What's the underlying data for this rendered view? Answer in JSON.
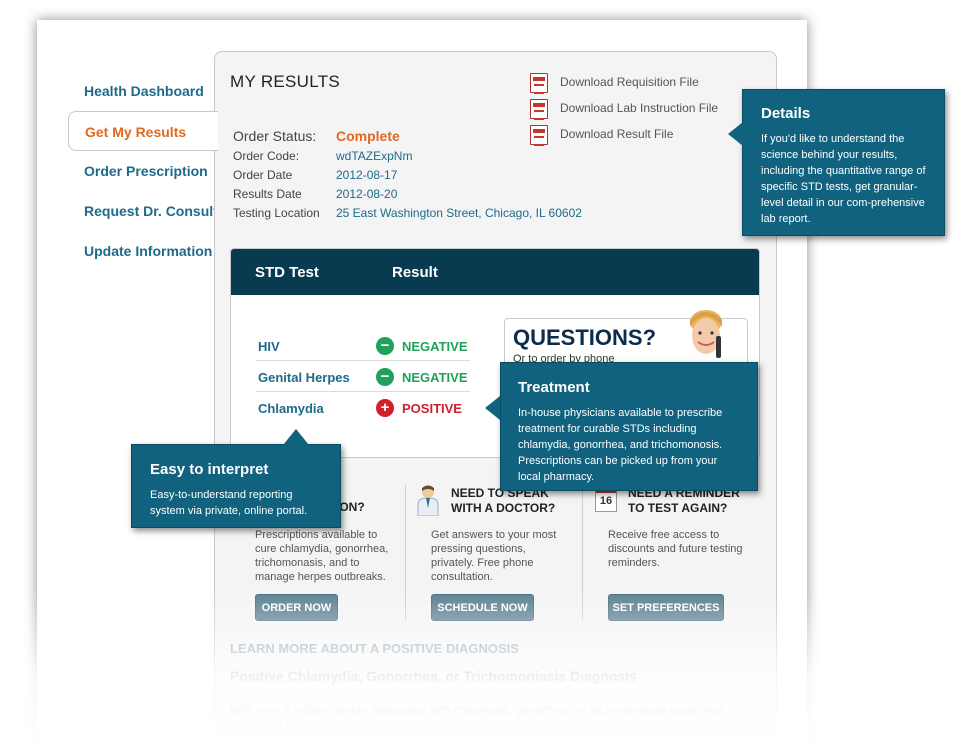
{
  "sidebar": {
    "items": [
      {
        "label": "Health Dashboard"
      },
      {
        "label": "Get My Results"
      },
      {
        "label": "Order Prescription"
      },
      {
        "label": "Request Dr. Consult"
      },
      {
        "label": "Update Information"
      }
    ]
  },
  "main": {
    "title": "MY RESULTS",
    "downloads": [
      {
        "label": "Download Requisition File"
      },
      {
        "label": "Download Lab Instruction File"
      },
      {
        "label": "Download Result File"
      }
    ],
    "order": {
      "status_label": "Order Status:",
      "status_value": "Complete",
      "code_label": "Order Code:",
      "code_value": "wdTAZExpNm",
      "date_label": "Order Date",
      "date_value": "2012-08-17",
      "results_label": "Results Date",
      "results_value": "2012-08-20",
      "location_label": "Testing Location",
      "location_value": "25 East Washington Street, Chicago, IL 60602"
    },
    "results_table": {
      "col_test": "STD Test",
      "col_result": "Result",
      "rows": [
        {
          "test": "HIV",
          "result": "NEGATIVE"
        },
        {
          "test": "Genital Herpes",
          "result": "NEGATIVE"
        },
        {
          "test": "Chlamydia",
          "result": "POSITIVE"
        }
      ]
    },
    "questions": {
      "title": "QUESTIONS?",
      "sub": "Or to order by phone"
    },
    "columns": [
      {
        "title": "ION?",
        "body": "Prescriptions available to cure chlamydia, gonorrhea, trichomonasis, and to manage herpes outbreaks.",
        "button": "ORDER NOW"
      },
      {
        "title": "NEED TO SPEAK WITH A DOCTOR?",
        "body": "Get answers to your most pressing questions, privately. Free phone consultation.",
        "button": "SCHEDULE NOW"
      },
      {
        "title": "NEED A REMINDER TO TEST AGAIN?",
        "body": "Receive free access to discounts and future testing reminders.",
        "button": "SET PREFERENCES",
        "calendar_num": "16"
      }
    ],
    "learn": {
      "header": "LEARN MORE ABOUT A POSITIVE DIAGNOSIS",
      "subheader": "Positive Chlamydia, Gonorrhea, or Trichomoniasis Diagnosis",
      "body": "With over 2 million people diagnosed with chlamydia, gonorrhea, or trichomoniasis each year, you're not alone. Fortunately, these common STDs are curable with antibiotics. To"
    }
  },
  "callouts": {
    "details": {
      "title": "Details",
      "body": "If you'd like to understand the science behind your results, including the quantitative range of specific STD tests, get granular-level detail in our com-prehensive lab report."
    },
    "treatment": {
      "title": "Treatment",
      "body": "In-house physicians available to prescribe treatment for curable STDs including chlamydia, gonorrhea, and trichomonosis. Prescriptions can be picked up from your local pharmacy."
    },
    "easy": {
      "title": "Easy to interpret",
      "body": "Easy-to-understand reporting system via private, online portal."
    }
  },
  "colors": {
    "accent_orange": "#e06a23",
    "link_blue": "#1e6a8a",
    "header_navy": "#083a50",
    "callout_blue": "#10627f",
    "negative_green": "#1fa15a",
    "positive_red": "#d0202a"
  }
}
